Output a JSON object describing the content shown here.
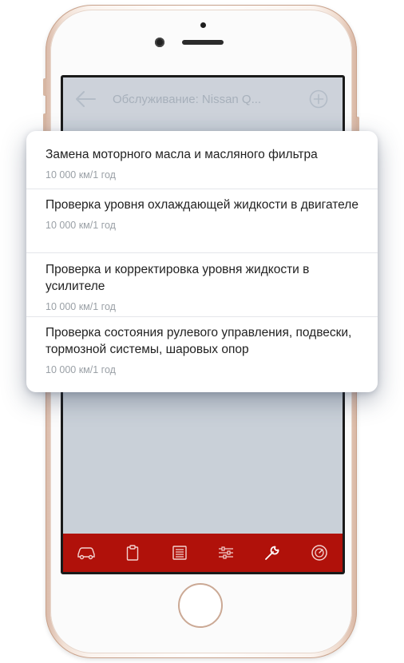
{
  "appbar": {
    "title": "Обслуживание: Nissan Q..."
  },
  "bottom_nav": {
    "tabs": [
      {
        "icon": "car-icon"
      },
      {
        "icon": "clipboard-icon"
      },
      {
        "icon": "list-icon"
      },
      {
        "icon": "sliders-icon"
      },
      {
        "icon": "wrench-icon"
      },
      {
        "icon": "gauge-icon"
      }
    ]
  },
  "colors": {
    "accent": "#b0110a",
    "appbar": "#cdd2da"
  },
  "maintenance": {
    "items": [
      {
        "title": "Замена моторного масла и масляного фильтра",
        "interval": "10 000 км/1 год"
      },
      {
        "title": "Проверка уровня охлаждающей жидкости в двигателе",
        "interval": "10 000 км/1 год"
      },
      {
        "title": "Проверка и корректировка уровня жидкости в усилителе",
        "interval": "10 000 км/1 год"
      },
      {
        "title": "Проверка состояния рулевого управления, подвески, тормозной системы, шаровых опор",
        "interval": "10 000 км/1 год"
      }
    ]
  }
}
